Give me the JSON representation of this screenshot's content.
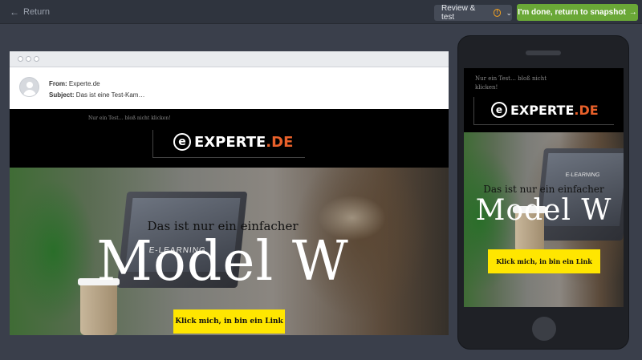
{
  "topbar": {
    "return_label": "Return",
    "review_label": "Review & test",
    "done_label": "I'm done, return to snapshot"
  },
  "desktop": {
    "from_label": "From:",
    "from_value": "Experte.de",
    "subject_label": "Subject:",
    "subject_value": "Das ist eine Test-Kam…"
  },
  "email": {
    "preheader": "Nur ein Test… bloß nicht klicken!",
    "logo_main": "EXPERTE",
    "logo_dot": ".DE",
    "hero_line1": "Das ist nur ein einfacher",
    "hero_line2": "Model W",
    "cta_label": "Klick mich, in bin ein Link",
    "screen_label": "E-LEARNING"
  },
  "mobile": {
    "preheader_line1": "Nur ein Test… bloß nicht",
    "preheader_line2": "klicken!",
    "hero_line1": "Das ist nur ein einfacher",
    "hero_line2": "Model W",
    "cta_label": "Klick mich, in bin ein Link"
  },
  "colors": {
    "background": "#3a3f4b",
    "topbar": "#2f343e",
    "done_button": "#6aa837",
    "cta": "#ffe600",
    "logo_accent": "#e8602a"
  }
}
